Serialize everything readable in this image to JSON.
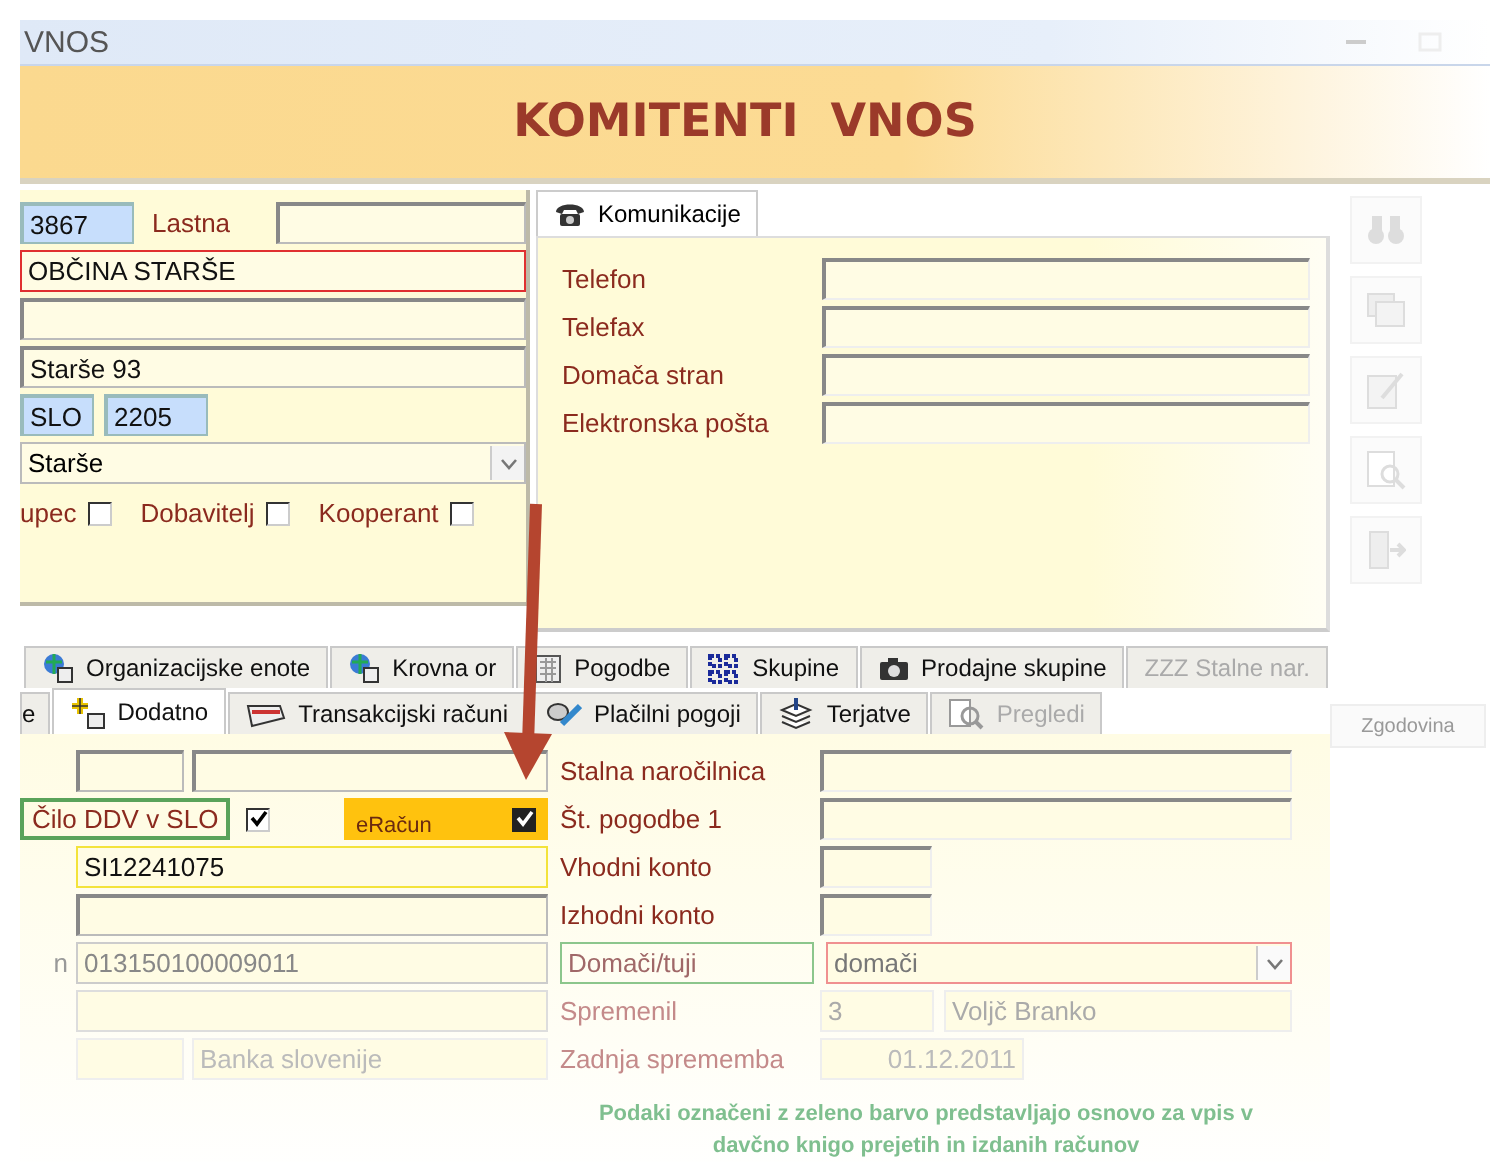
{
  "window": {
    "title": "VNOS"
  },
  "header": {
    "title": "KOMITENTI  VNOS"
  },
  "general": {
    "code": "3867",
    "owner_label": "Lastna",
    "name": "OBČINA STARŠE",
    "address": "Starše 93",
    "country": "SLO",
    "postal_code": "2205",
    "city": "Starše",
    "roles": [
      {
        "label": "upec",
        "checked": false
      },
      {
        "label": "Dobavitelj",
        "checked": false
      },
      {
        "label": "Kooperant",
        "checked": false
      }
    ]
  },
  "communication": {
    "tab": "Komunikacije",
    "fields": [
      {
        "label": "Telefon"
      },
      {
        "label": "Telefax"
      },
      {
        "label": "Domača stran"
      },
      {
        "label": "Elektronska pošta"
      }
    ]
  },
  "tab_rows": [
    {
      "tabs": [
        {
          "label": "Organizacijske enote",
          "kind": "globe",
          "selected": false,
          "disabled": false
        },
        {
          "label": "Krovna or",
          "kind": "globe",
          "selected": false,
          "disabled": false
        },
        {
          "label": "Pogodbe",
          "kind": "sheet",
          "selected": false,
          "disabled": false
        },
        {
          "label": "Skupine",
          "kind": "dots",
          "selected": false,
          "disabled": false
        },
        {
          "label": "Prodajne skupine",
          "kind": "camera",
          "selected": false,
          "disabled": false
        },
        {
          "label": "ZZZ Stalne nar.",
          "kind": "text",
          "selected": false,
          "disabled": true
        }
      ]
    },
    {
      "tabs": [
        {
          "label": "e",
          "kind": "text",
          "selected": false,
          "disabled": false
        },
        {
          "label": "Dodatno",
          "kind": "plus",
          "selected": true,
          "disabled": false
        },
        {
          "label": "Transakcijski računi",
          "kind": "card",
          "selected": false,
          "disabled": false
        },
        {
          "label": "Plačilni pogoji",
          "kind": "coins",
          "selected": false,
          "disabled": false
        },
        {
          "label": "Terjatve",
          "kind": "stack",
          "selected": false,
          "disabled": false
        },
        {
          "label": "Pregledi",
          "kind": "magnifier",
          "selected": false,
          "disabled": true
        }
      ]
    }
  ],
  "details": {
    "vat": {
      "label": "Čilo DDV v SLO",
      "checked": true
    },
    "einvoice": {
      "label": "eRačun",
      "checked": true
    },
    "tax_id": "SI12241075",
    "account_label": "n",
    "account": "013150100009011",
    "bank": "Banka slovenije"
  },
  "right_fields": [
    {
      "label": "Stalna naročilnica",
      "kind": "wide"
    },
    {
      "label": "Št. pogodbe 1",
      "kind": "wide"
    },
    {
      "label": "Vhodni konto",
      "kind": "short"
    },
    {
      "label": "Izhodni konto",
      "kind": "short"
    }
  ],
  "domestic": {
    "label": "Domači/tuji",
    "value": "domači"
  },
  "changed_by": {
    "label": "Spremenil",
    "id": "3",
    "name": "Voljč Branko"
  },
  "last_change": {
    "label": "Zadnja sprememba",
    "value": "01.12.2011"
  },
  "note": "Podaki označeni z zeleno barvo predstavljajo osnovo za vpis v davčno knigo prejetih in izdanih računov",
  "history_button": "Zgodovina",
  "toolbar": [
    {
      "kind": "search"
    },
    {
      "kind": "forms"
    },
    {
      "kind": "edit"
    },
    {
      "kind": "preview"
    },
    {
      "kind": "exit"
    }
  ]
}
